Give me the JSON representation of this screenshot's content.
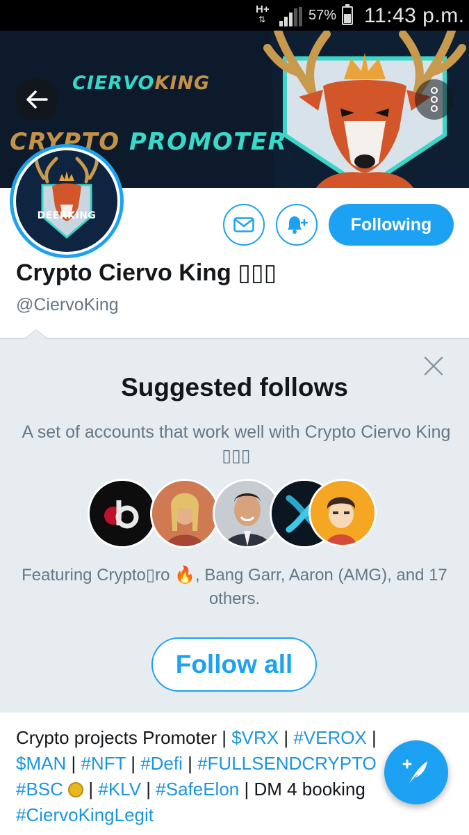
{
  "status_bar": {
    "network": "H+",
    "network_arrows": "⇅",
    "battery_percent": "57%",
    "battery_level": 0.57,
    "time": "11:43 p.m."
  },
  "banner": {
    "title_part1": "CIERVO",
    "title_part2": "KING",
    "subtitle_part1": "CRYPTO",
    "subtitle_part2": " PROMOTER"
  },
  "profile": {
    "avatar_text": "DEERKING",
    "display_name": "Crypto Ciervo King ▯▯▯",
    "handle": "@CiervoKing",
    "following_label": "Following"
  },
  "suggested": {
    "title": "Suggested follows",
    "description": "A set of accounts that work well with Crypto Ciervo King ▯▯▯",
    "featuring": "Featuring Crypto▯ro 🔥, Bang Garr, Aaron (AMG), and 17 others.",
    "follow_all_label": "Follow all"
  },
  "bio": {
    "t1": "Crypto projects Promoter | ",
    "l1": "$VRX",
    "t2": " | ",
    "l2": "#VEROX",
    "t3": " | ",
    "l3": "$MAN",
    "t4": " | ",
    "l4": "#NFT",
    "t5": " | ",
    "l5": "#Defi",
    "t6": " | ",
    "l6": "#FULLSENDCRYPTO",
    "t7": "",
    "l7": "#BSC",
    "t8": " | ",
    "l8": "#KLV",
    "t9": " | ",
    "l9": "#SafeElon",
    "t10": " | DM 4 booking",
    "l10": "#CiervoKingLegit"
  },
  "colors": {
    "accent": "#1da1f2",
    "panel_bg": "#e6ecf0",
    "muted_text": "#657786"
  }
}
